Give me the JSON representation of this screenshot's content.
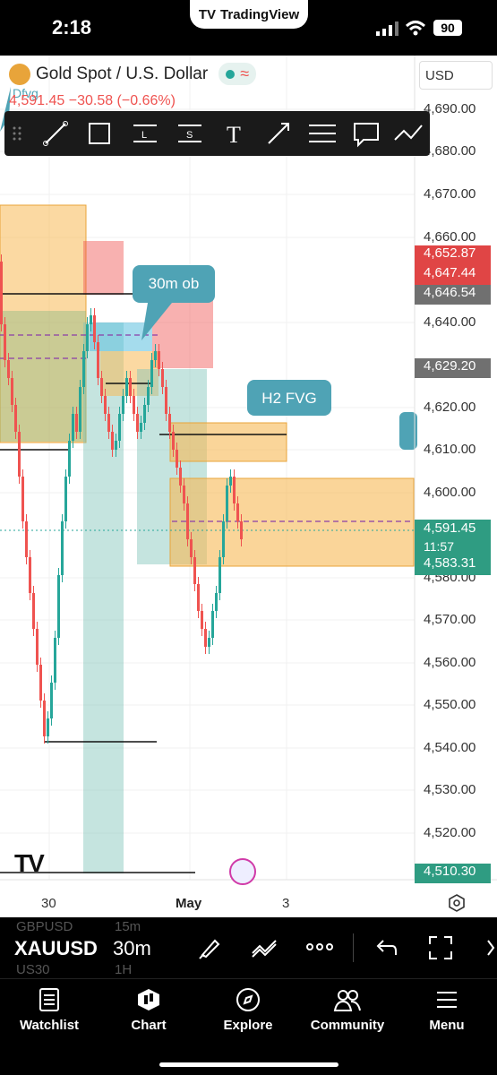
{
  "status_bar": {
    "time": "2:18",
    "app_name": "TradingView",
    "battery": "90"
  },
  "chart": {
    "title": "Gold Spot / U.S. Dollar",
    "quote": "4,591.45 −30.58 (−0.66%)",
    "currency": "USD",
    "price_axis": [
      "4,690.00",
      "4,680.00",
      "4,670.00",
      "4,660.00",
      "4,640.00",
      "4,620.00",
      "4,610.00",
      "4,600.00",
      "4,580.00",
      "4,570.00",
      "4,560.00",
      "4,550.00",
      "4,540.00",
      "4,530.00",
      "4,520.00"
    ],
    "price_tags": {
      "tag1": "4,652.87",
      "tag2": "4,647.44",
      "tag3": "4,646.54",
      "tag4": "4,629.20",
      "current": "4,591.45",
      "countdown": "11:57",
      "tag5": "4,583.31",
      "tag6": "4,510.30"
    },
    "time_axis": [
      "30",
      "May",
      "3"
    ],
    "annotations": {
      "ob": "30m ob",
      "fvg": "H2 FVG",
      "dfvg": "Dfvg"
    },
    "colors": {
      "bull": "#26a69a",
      "bear": "#ef5350",
      "fvg_zone": "#f7b955",
      "ob_zone": "#ef5350",
      "callout": "#4fa3b5"
    }
  },
  "symbol_bar": {
    "symbol": "XAUUSD",
    "interval": "30m",
    "prev_symbol": "GBPUSD",
    "prev_interval": "15m",
    "next_symbol": "US30",
    "next_interval": "1H"
  },
  "nav": {
    "watchlist": "Watchlist",
    "chart": "Chart",
    "explore": "Explore",
    "community": "Community",
    "menu": "Menu"
  }
}
